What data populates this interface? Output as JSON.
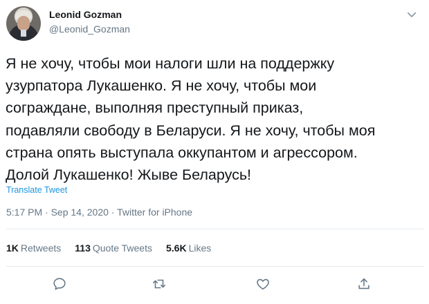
{
  "author": {
    "name": "Leonid Gozman",
    "handle": "@Leonid_Gozman"
  },
  "tweet": {
    "text": "Я не хочу, чтобы мои налоги шли на поддержку\nузурпатора Лукашенко. Я не хочу, чтобы мои\nсограждане, выполняя преступный приказ,\nподавляли свободу в Беларуси. Я не хочу, чтобы моя\nстрана опять выступала  оккупантом и агрессором.\nДолой Лукашенко! Жыве Беларусь!",
    "translate_label": "Translate Tweet",
    "time": "5:17 PM",
    "separator": " · ",
    "date": "Sep 14, 2020",
    "source": "Twitter for iPhone"
  },
  "stats": {
    "retweets_count": "1K",
    "retweets_label": "Retweets",
    "quotes_count": "113",
    "quotes_label": "Quote Tweets",
    "likes_count": "5.6K",
    "likes_label": "Likes"
  },
  "icons": {
    "menu": "chevron-down-icon",
    "reply": "reply-icon",
    "retweet": "retweet-icon",
    "like": "heart-icon",
    "share": "share-icon"
  },
  "colors": {
    "text": "#14171a",
    "secondary": "#657786",
    "link": "#1b95e0",
    "divider": "#e6ecf0"
  }
}
